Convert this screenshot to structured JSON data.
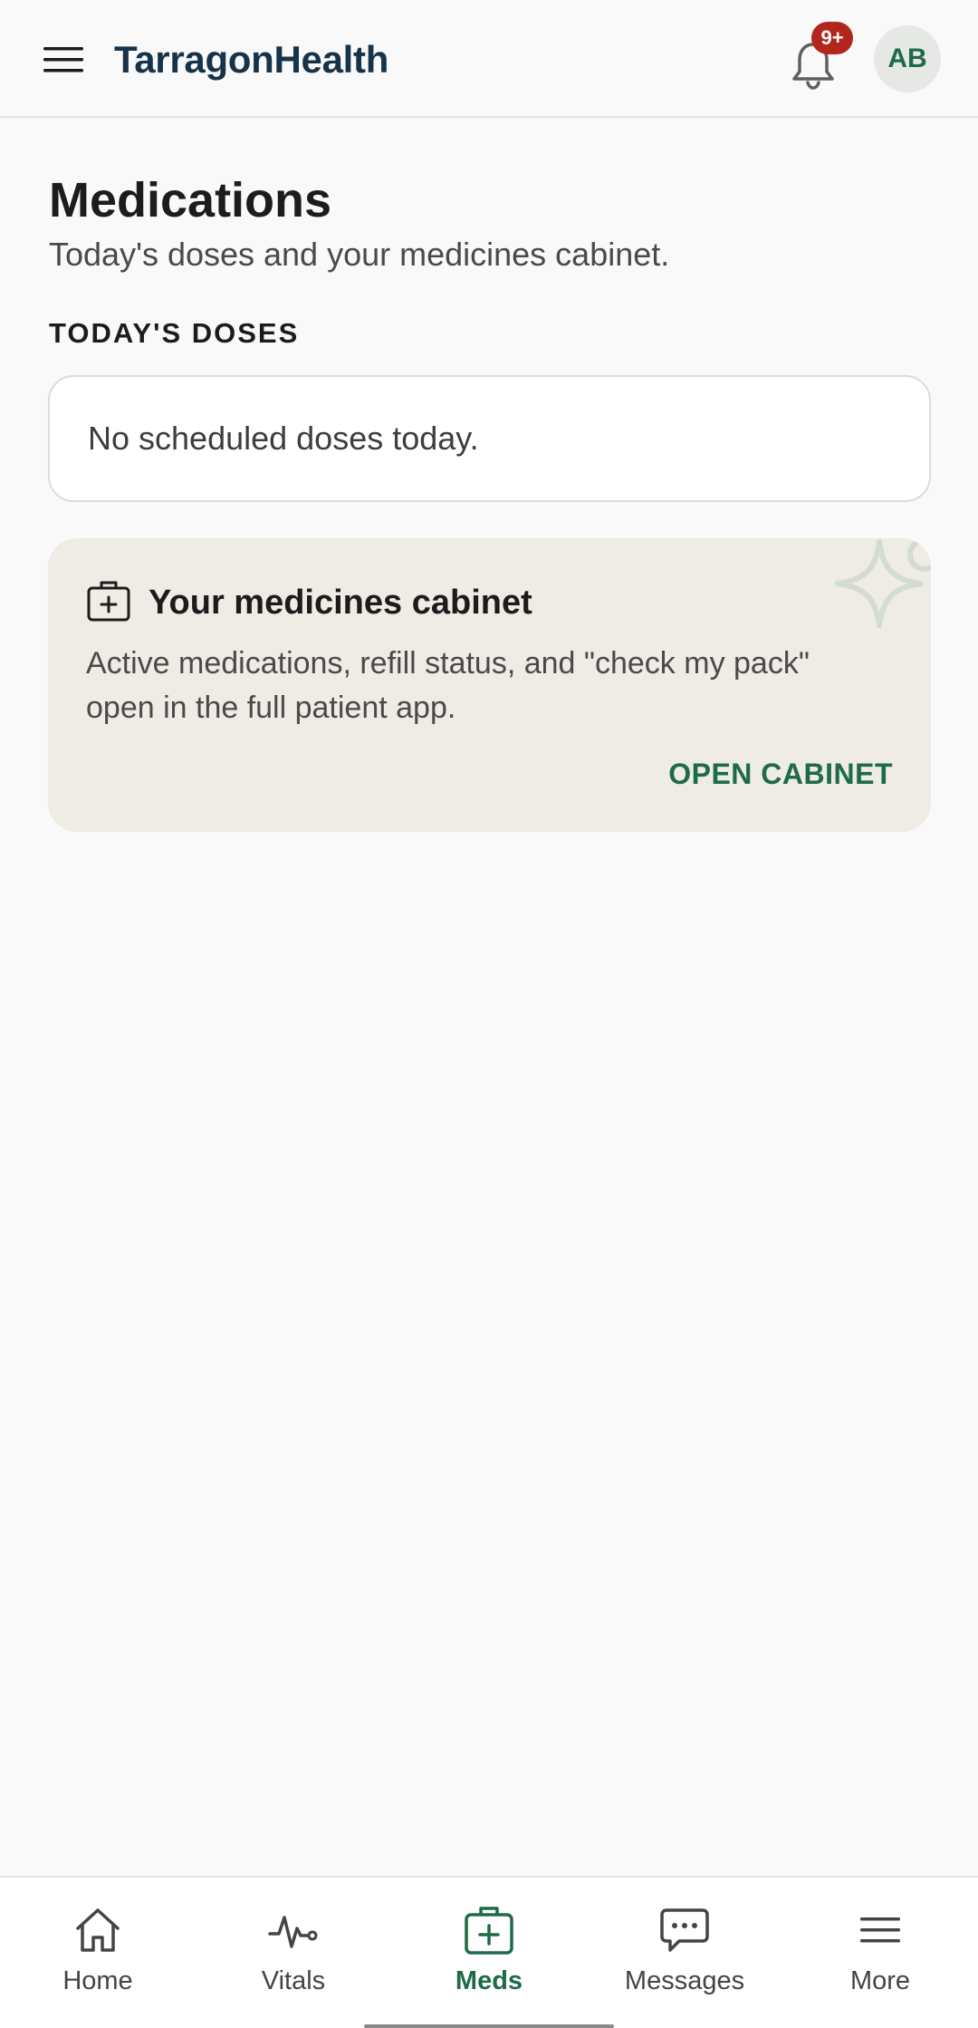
{
  "header": {
    "brand": "TarragonHealth",
    "notification_badge": "9+",
    "avatar_initials": "AB"
  },
  "page": {
    "title": "Medications",
    "subtitle": "Today's doses and your medicines cabinet."
  },
  "doses": {
    "section_label": "TODAY'S DOSES",
    "empty_message": "No scheduled doses today."
  },
  "cabinet": {
    "title": "Your medicines cabinet",
    "description": "Active medications, refill status, and \"check my pack\" open in the full patient app.",
    "action_label": "OPEN CABINET"
  },
  "nav": {
    "items": [
      {
        "label": "Home",
        "icon": "home-icon"
      },
      {
        "label": "Vitals",
        "icon": "pulse-icon"
      },
      {
        "label": "Meds",
        "icon": "medkit-icon",
        "active": true
      },
      {
        "label": "Messages",
        "icon": "chat-icon"
      },
      {
        "label": "More",
        "icon": "menu-icon"
      }
    ]
  },
  "colors": {
    "brand_text": "#17334a",
    "accent": "#1e6b47",
    "badge": "#b3261e",
    "cabinet_bg": "#efebe5"
  }
}
